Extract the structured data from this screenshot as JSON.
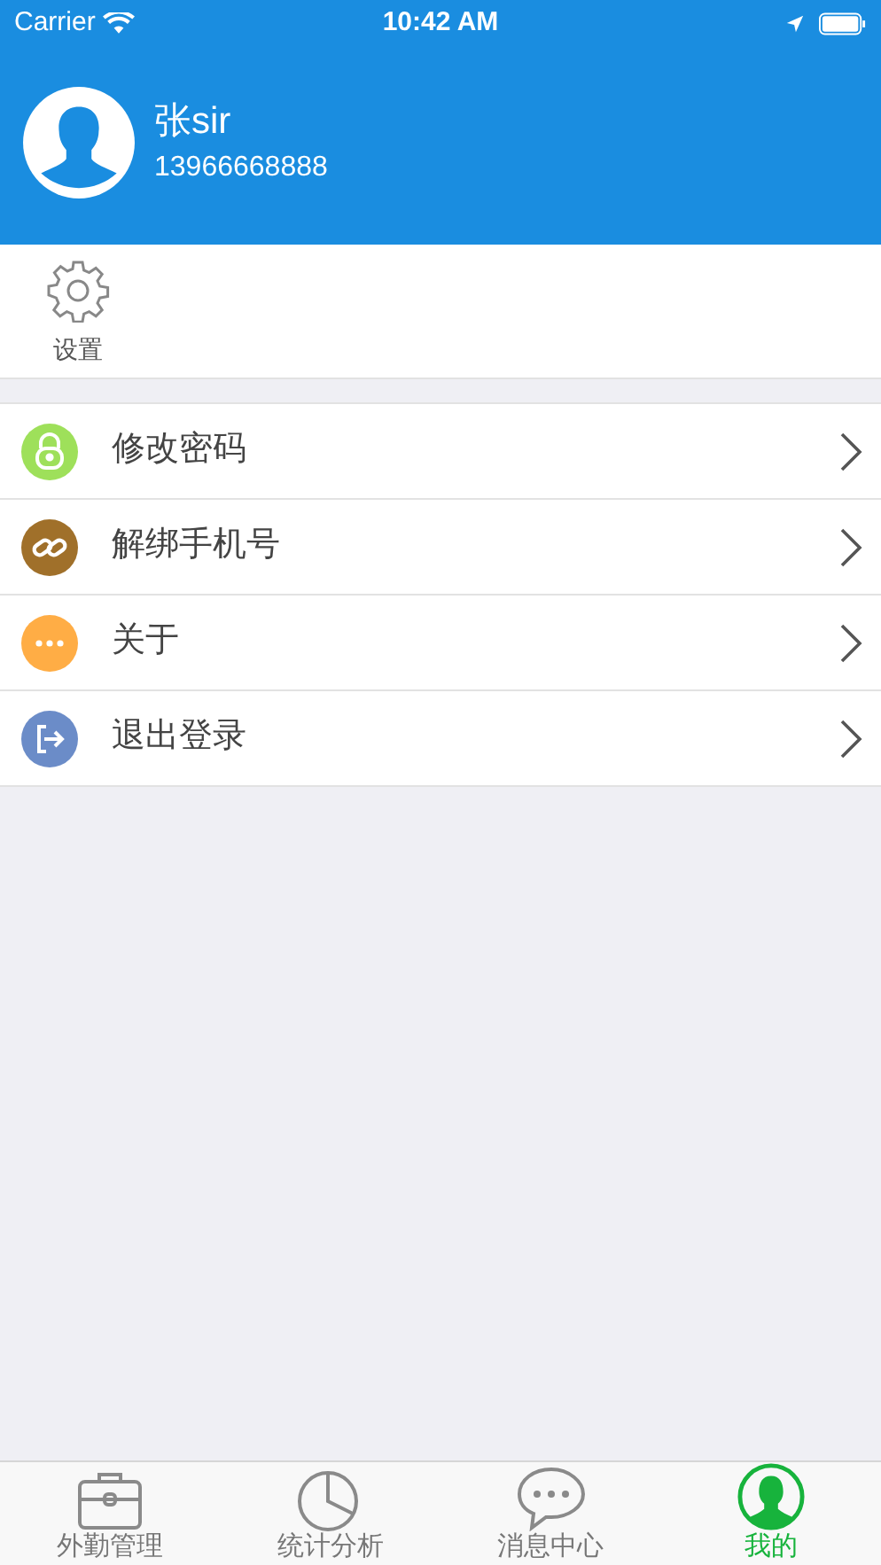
{
  "status_bar": {
    "carrier": "Carrier",
    "time": "10:42 AM"
  },
  "profile": {
    "name": "张sir",
    "phone": "13966668888"
  },
  "shortcuts": [
    {
      "label": "设置",
      "kind": "gear"
    }
  ],
  "menu": [
    {
      "label": "修改密码",
      "kind": "lock",
      "color": "#9ee05a"
    },
    {
      "label": "解绑手机号",
      "kind": "link",
      "color": "#a0702a"
    },
    {
      "label": "关于",
      "kind": "dots",
      "color": "#ffad45"
    },
    {
      "label": "退出登录",
      "kind": "exit",
      "color": "#6b8cc8"
    }
  ],
  "tabs": [
    {
      "label": "外勤管理",
      "kind": "briefcase",
      "selected": false
    },
    {
      "label": "统计分析",
      "kind": "pie",
      "selected": false
    },
    {
      "label": "消息中心",
      "kind": "chat",
      "selected": false
    },
    {
      "label": "我的",
      "kind": "person",
      "selected": true
    }
  ]
}
